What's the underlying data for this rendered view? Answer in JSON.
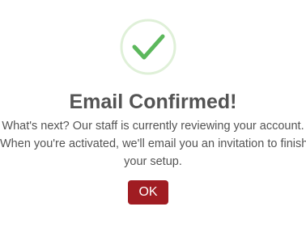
{
  "dialog": {
    "icon": "success-checkmark-icon",
    "title": "Email Confirmed!",
    "message_lines": [
      "What's next? Our staff is currently reviewing your account.",
      "When you're activated, we'll email you an invitation to finish",
      "your setup."
    ],
    "ok_label": "OK"
  },
  "colors": {
    "check": "#5cb85c",
    "ring": "#dff0d8",
    "button": "#a01c22",
    "text": "#545454"
  }
}
